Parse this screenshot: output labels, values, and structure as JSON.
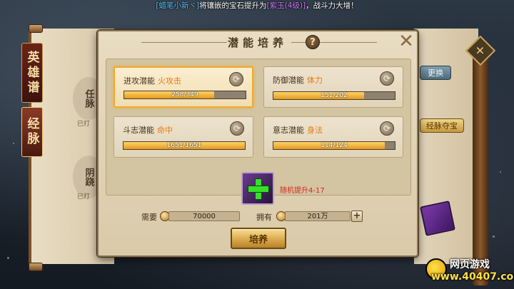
{
  "announcement": {
    "name": "[蜡笔小新ヾ]",
    "text_before": "将镶嵌的宝石提升为",
    "gem": "[紫玉(4级)]",
    "text_after": "，战斗力大增！"
  },
  "left_tabs": [
    {
      "label": "英雄谱"
    },
    {
      "label": "经脉"
    }
  ],
  "left_items": [
    {
      "label": "任脉",
      "sub": "已打"
    },
    {
      "label": "阴跷",
      "sub": "已打"
    }
  ],
  "right_panel": {
    "change_button": "更换",
    "meridian_button": "经脉夺宝"
  },
  "dialog": {
    "title": "潜能培养",
    "help": "?",
    "close": "✕",
    "cards": [
      {
        "label": "进攻潜能",
        "value": "火攻击",
        "current": 258,
        "max": 349,
        "progress_text": "258/349",
        "active": true
      },
      {
        "label": "防御潜能",
        "value": "体力",
        "current": 151,
        "max": 202,
        "progress_text": "151/202",
        "active": false
      },
      {
        "label": "斗志潜能",
        "value": "命中",
        "current": 1651,
        "max": 1651,
        "progress_text": "1651/1651",
        "active": false
      },
      {
        "label": "意志潜能",
        "value": "身法",
        "current": 114,
        "max": 124,
        "progress_text": "114/124",
        "active": false
      }
    ],
    "refresh_glyph": "⟳",
    "bonus_text": "随机提升4-17",
    "need_label": "需要",
    "need_amount": "70000",
    "have_label": "拥有",
    "have_amount": "201万",
    "add_glyph": "+",
    "train_button": "培养"
  },
  "watermark": {
    "title": "网页游戏",
    "url": "www.40407.com"
  },
  "colors": {
    "accent_orange": "#e67a10",
    "bonus_red": "#d62a1a",
    "bar_fill": "#e49a1c",
    "active_border": "#f0a830"
  }
}
